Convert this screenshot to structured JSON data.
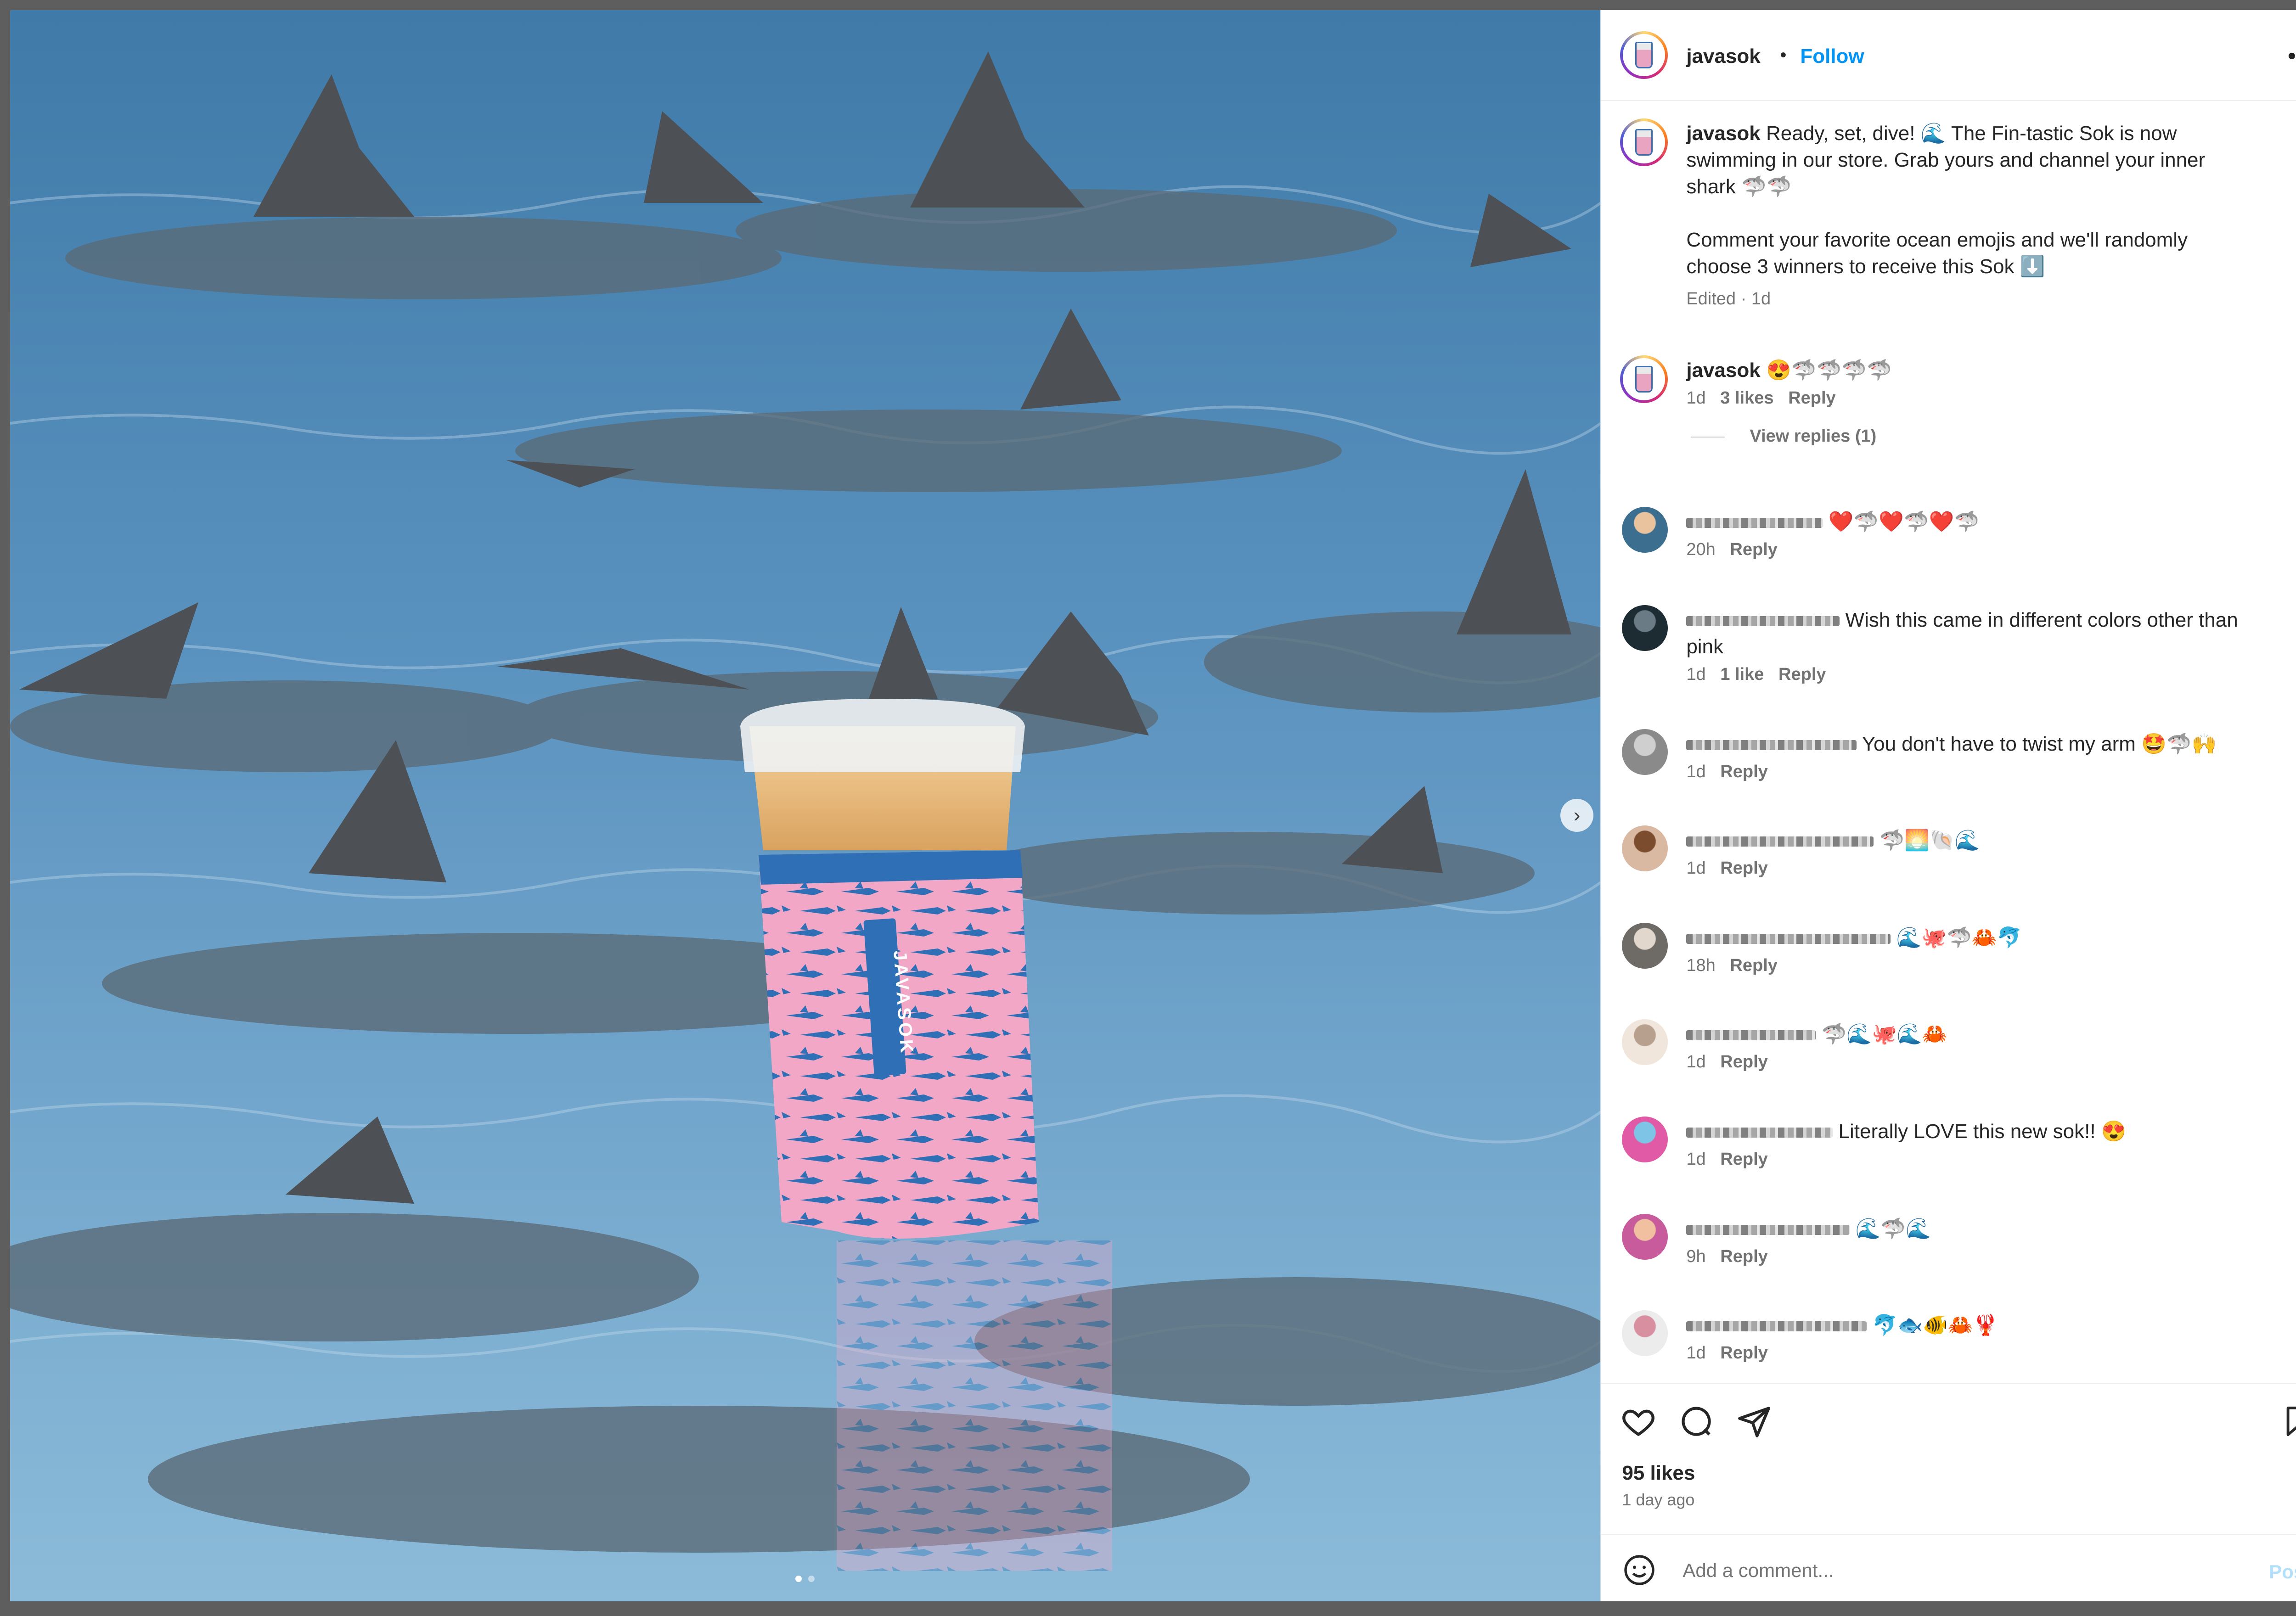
{
  "post": {
    "username": "javasok",
    "separator": "•",
    "follow_label": "Follow",
    "more_icon": "more-horizontal-icon"
  },
  "caption": {
    "username": "javasok",
    "line1": "Ready, set, dive! 🌊 The Fin-tastic Sok is now",
    "line2": "swimming in our store. Grab yours and channel your inner",
    "line3": "shark 🦈🦈",
    "line4": "Comment your favorite ocean emojis and we'll randomly",
    "line5": "choose 3 winners to receive this Sok ⬇️",
    "meta": "Edited · 1d"
  },
  "comments": [
    {
      "user": "javasok",
      "text": "😍🦈🦈🦈🦈",
      "time": "1d",
      "likes": "3 likes",
      "reply": "Reply",
      "view_replies": "View replies (1)"
    },
    {
      "user": "",
      "text": "❤️🦈❤️🦈❤️🦈",
      "time": "20h",
      "likes": "",
      "reply": "Reply"
    },
    {
      "user": "",
      "text": "Wish this came in different colors other than",
      "text2": "pink",
      "time": "1d",
      "likes": "1 like",
      "reply": "Reply"
    },
    {
      "user": "",
      "text": "You don't have to twist my arm 🤩🦈🙌",
      "time": "1d",
      "likes": "",
      "reply": "Reply"
    },
    {
      "user": "",
      "text": "🦈🌅🐚🌊",
      "time": "1d",
      "likes": "",
      "reply": "Reply"
    },
    {
      "user": "",
      "text": "🌊🐙🦈🦀🐬",
      "time": "18h",
      "likes": "",
      "reply": "Reply"
    },
    {
      "user": "",
      "text": "🦈🌊🐙🌊🦀",
      "time": "1d",
      "likes": "",
      "reply": "Reply"
    },
    {
      "user": "",
      "text": "Literally LOVE this new sok!! 😍",
      "time": "1d",
      "likes": "",
      "reply": "Reply"
    },
    {
      "user": "",
      "text": "🌊🦈🌊",
      "time": "9h",
      "likes": "",
      "reply": "Reply"
    },
    {
      "user": "",
      "text": "🐬🐟🐠🦀🦞",
      "time": "1d",
      "likes": "",
      "reply": "Reply"
    }
  ],
  "engagement": {
    "likes": "95 likes",
    "time_ago": "1 day ago"
  },
  "composer": {
    "placeholder": "Add a comment...",
    "post_label": "Post"
  },
  "media": {
    "sleeve_brand": "JAVASOK",
    "carousel_count": 2,
    "carousel_active": 0
  },
  "colors": {
    "accent": "#0095f6",
    "text": "#262626",
    "muted": "#737373",
    "sleeve_pink": "#f2a7c6",
    "sleeve_blue": "#2f6fb5"
  }
}
